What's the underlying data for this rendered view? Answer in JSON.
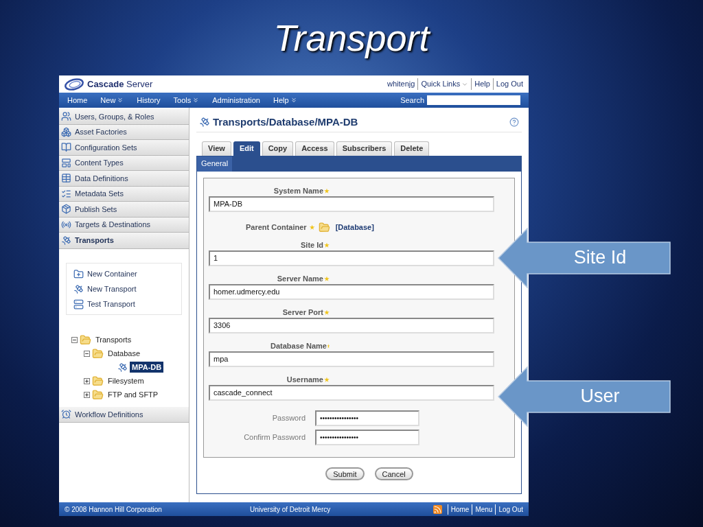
{
  "slide": {
    "title": "Transport"
  },
  "header": {
    "logo": "**Cascade** Server",
    "user_links": [
      "whitenjg",
      "Quick Links",
      "Help",
      "Log Out"
    ]
  },
  "nav": {
    "items": [
      {
        "label": "Home",
        "menu": false
      },
      {
        "label": "New",
        "menu": true
      },
      {
        "label": "History",
        "menu": false
      },
      {
        "label": "Tools",
        "menu": true
      },
      {
        "label": "Administration",
        "menu": false
      },
      {
        "label": "Help",
        "menu": true
      }
    ],
    "search_label": "Search"
  },
  "sidebar": {
    "items": [
      {
        "label": "Users, Groups, & Roles",
        "selected": false
      },
      {
        "label": "Asset Factories",
        "selected": false
      },
      {
        "label": "Configuration Sets",
        "selected": false
      },
      {
        "label": "Content Types",
        "selected": false
      },
      {
        "label": "Data Definitions",
        "selected": false
      },
      {
        "label": "Metadata Sets",
        "selected": false
      },
      {
        "label": "Publish Sets",
        "selected": false
      },
      {
        "label": "Targets & Destinations",
        "selected": false
      },
      {
        "label": "Transports",
        "selected": true
      }
    ],
    "actions": [
      "New Container",
      "New Transport",
      "Test Transport"
    ],
    "tree": [
      {
        "label": "Transports",
        "expanded": true,
        "selected": false,
        "children": [
          {
            "label": "Database",
            "expanded": true,
            "selected": false,
            "children": [
              {
                "label": "MPA-DB",
                "selected": true
              }
            ]
          },
          {
            "label": "Filesystem",
            "expanded": false,
            "selected": false
          },
          {
            "label": "FTP and SFTP",
            "expanded": false,
            "selected": false
          }
        ]
      }
    ],
    "bottom_items": [
      {
        "label": "Workflow Definitions",
        "selected": false
      }
    ]
  },
  "content": {
    "title": "Transports/Database/MPA-DB",
    "tabs": [
      {
        "label": "View",
        "selected": false
      },
      {
        "label": "Edit",
        "selected": true
      },
      {
        "label": "Copy",
        "selected": false
      },
      {
        "label": "Access",
        "selected": false
      },
      {
        "label": "Subscribers",
        "selected": false
      },
      {
        "label": "Delete",
        "selected": false
      }
    ],
    "subtab": "General",
    "fields": [
      {
        "kind": "text",
        "label": "System Name",
        "required": true,
        "value": "MPA-DB"
      },
      {
        "kind": "link",
        "label": "Parent Container",
        "required": true,
        "value": "[Database]"
      },
      {
        "kind": "text",
        "label": "Site Id",
        "required": true,
        "value": "1"
      },
      {
        "kind": "text",
        "label": "Server Name",
        "required": true,
        "value": "homer.udmercy.edu"
      },
      {
        "kind": "text",
        "label": "Server Port",
        "required": true,
        "value": "3306"
      },
      {
        "kind": "text",
        "label": "Database Name",
        "required": true,
        "value": "mpa"
      },
      {
        "kind": "text",
        "label": "Username",
        "required": true,
        "value": "cascade_connect"
      },
      {
        "kind": "password",
        "label": "Password",
        "required": false,
        "value": "••••••••••••••••"
      },
      {
        "kind": "password",
        "label": "Confirm Password",
        "required": false,
        "value": "••••••••••••••••"
      }
    ],
    "buttons": [
      "Submit",
      "Cancel"
    ]
  },
  "footer": {
    "copyright": "© 2008 Hannon Hill Corporation",
    "organization": "University of Detroit Mercy",
    "links": [
      "Home",
      "Menu",
      "Log Out"
    ]
  },
  "callouts": [
    {
      "text": "Site Id"
    },
    {
      "text": "User"
    }
  ]
}
